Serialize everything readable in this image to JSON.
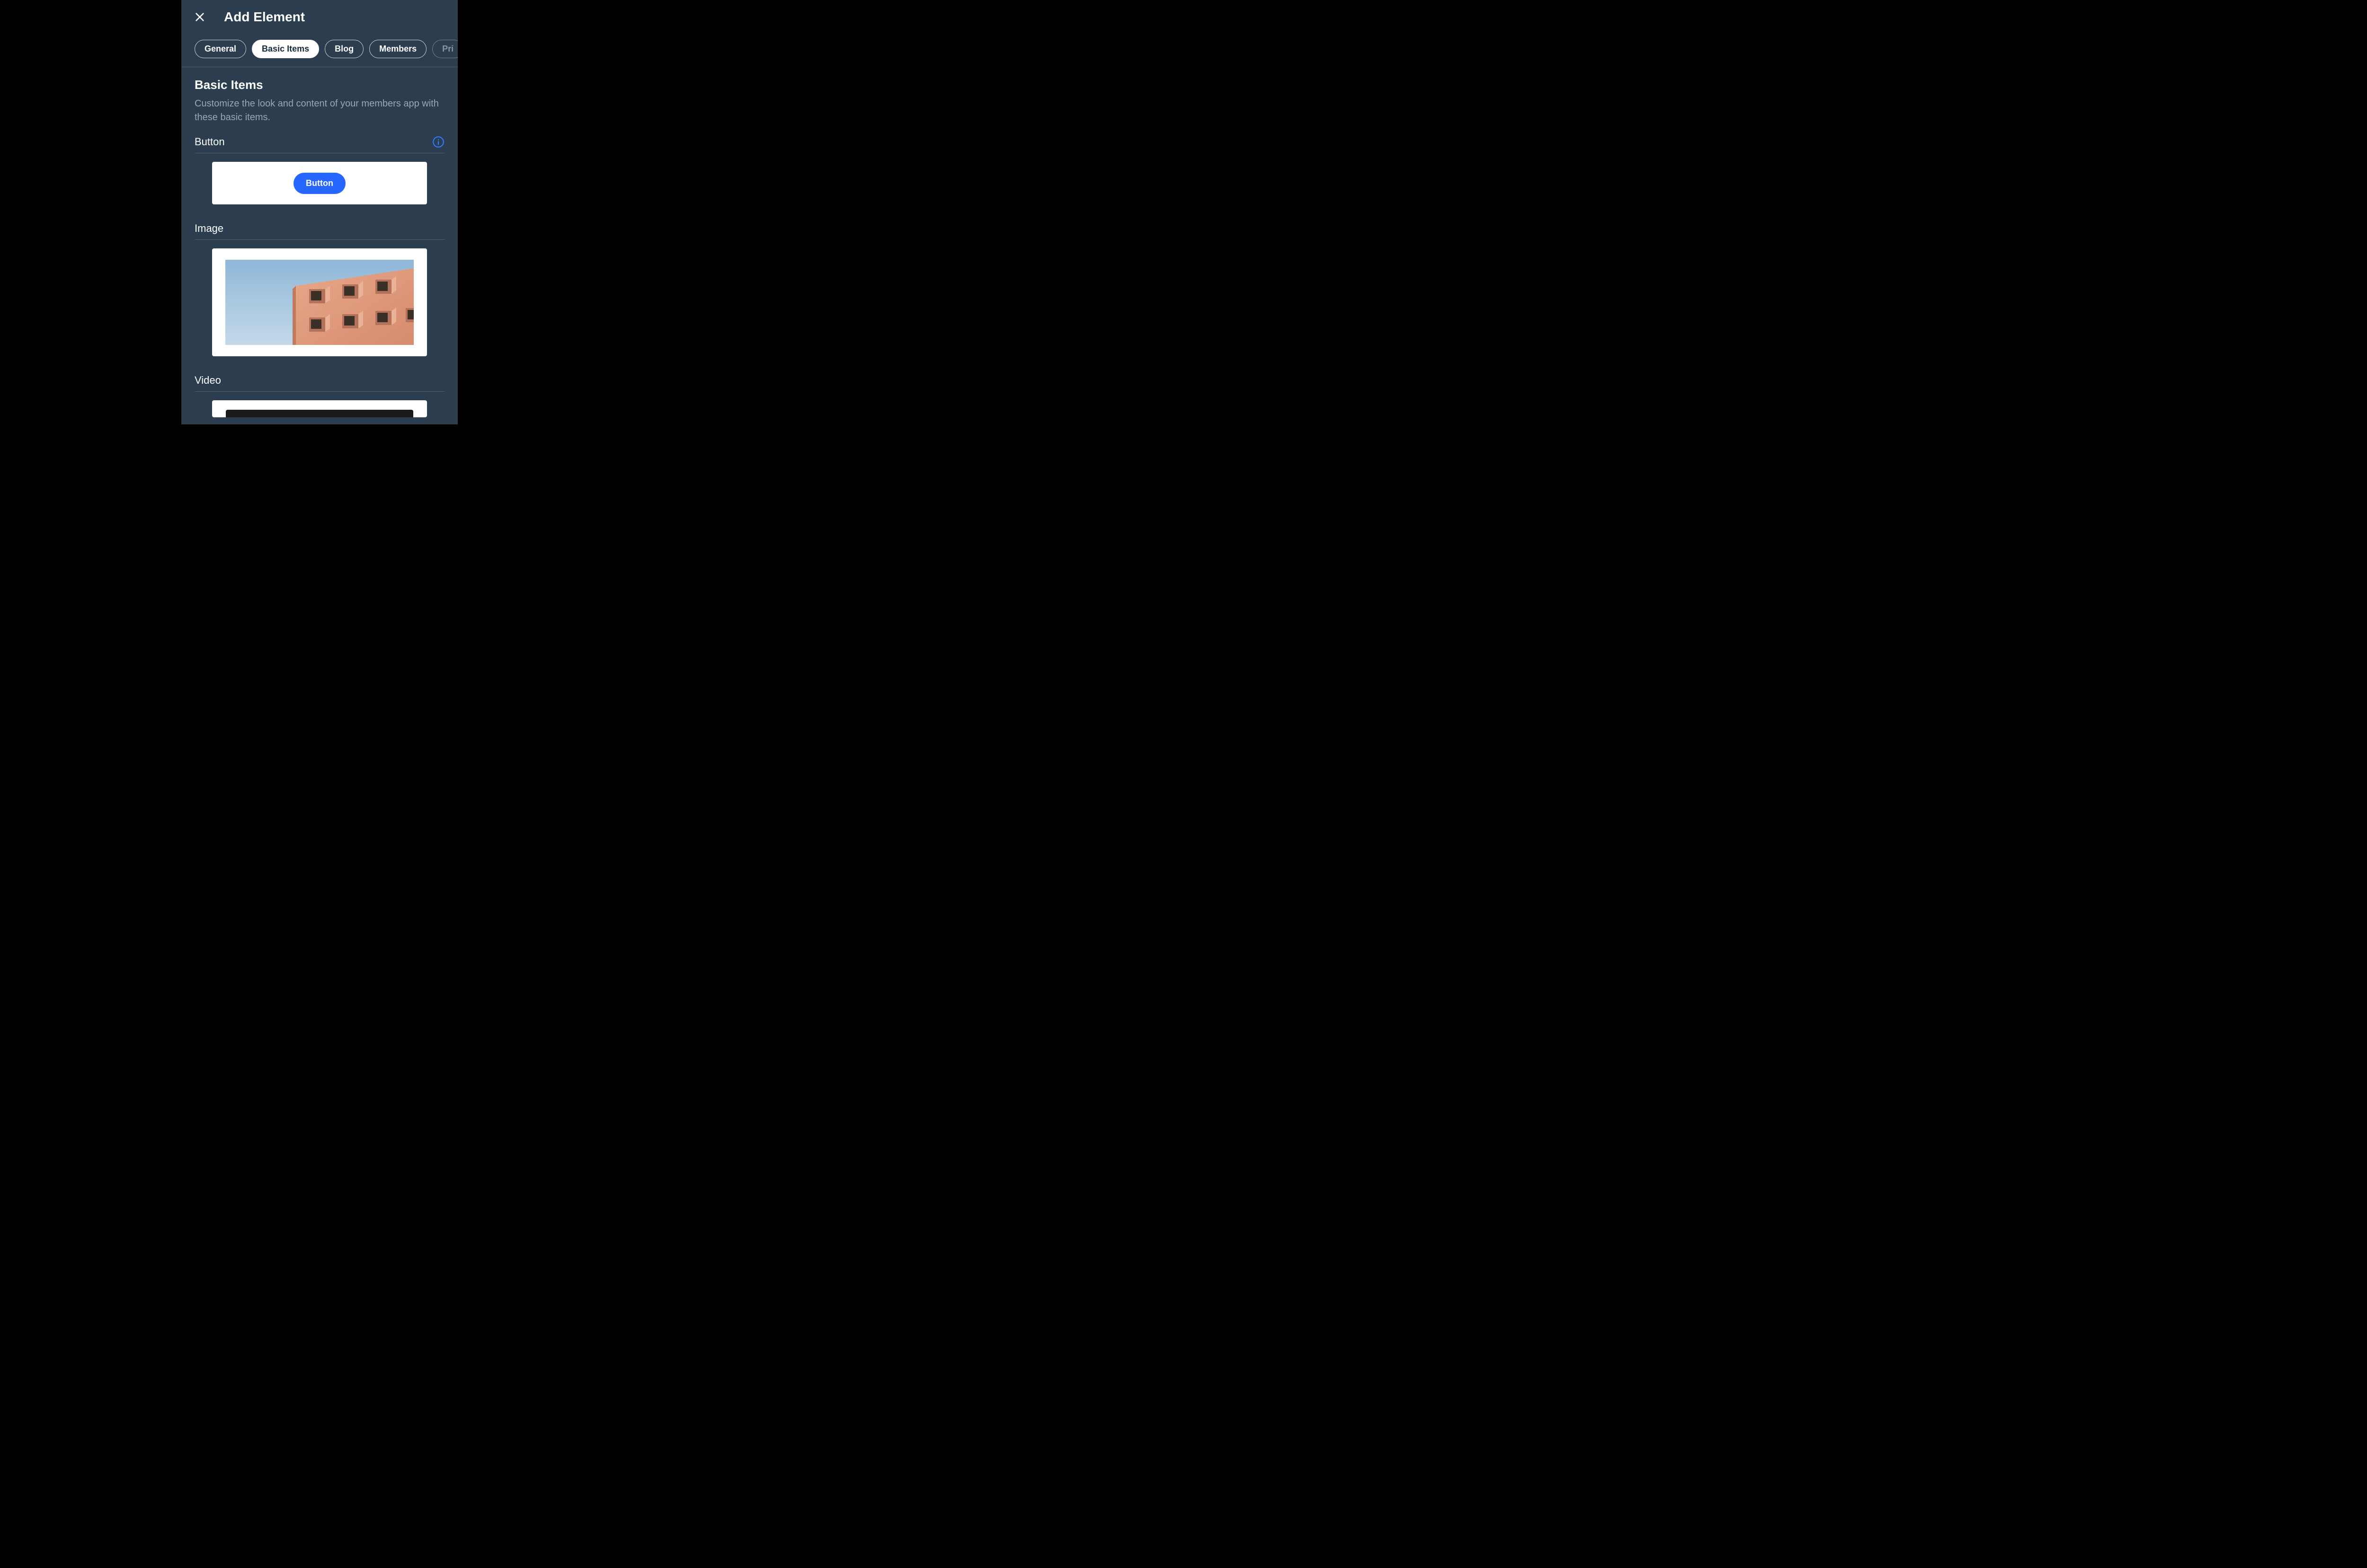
{
  "header": {
    "title": "Add Element"
  },
  "tabs": [
    {
      "label": "General",
      "active": false
    },
    {
      "label": "Basic Items",
      "active": true
    },
    {
      "label": "Blog",
      "active": false
    },
    {
      "label": "Members",
      "active": false
    },
    {
      "label": "Pri",
      "active": false,
      "dim": true
    }
  ],
  "section": {
    "title": "Basic Items",
    "description": "Customize the look and content of your members app with these basic items."
  },
  "items": [
    {
      "label": "Button",
      "has_info": true,
      "preview_button_label": "Button"
    },
    {
      "label": "Image",
      "has_info": false
    },
    {
      "label": "Video",
      "has_info": false
    }
  ],
  "colors": {
    "accent": "#2766ff",
    "panel_bg": "#2b3d4f"
  }
}
